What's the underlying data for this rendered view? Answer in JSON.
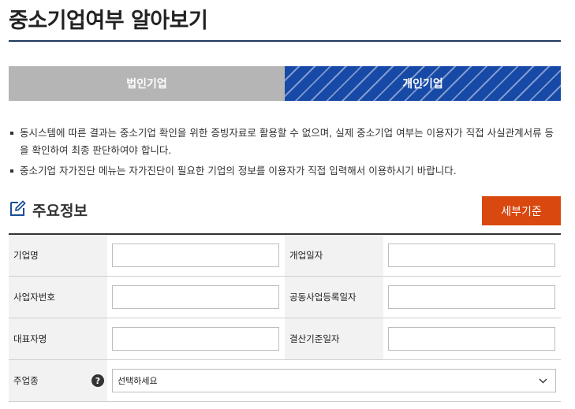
{
  "page": {
    "title": "중소기업여부 알아보기"
  },
  "tabs": [
    {
      "label": "법인기업",
      "active": false
    },
    {
      "label": "개인기업",
      "active": true
    }
  ],
  "notice": {
    "items": [
      "동시스템에 따른 결과는 중소기업 확인을 위한 증빙자료로 활용할 수 없으며, 실제 중소기업 여부는 이용자가 직접 사실관계서류 등을 확인하여 최종 판단하여야 합니다.",
      "중소기업 자가진단 메뉴는 자가진단이 필요한 기업의 정보를 이용자가 직접 입력해서 이용하시기 바랍니다."
    ]
  },
  "section": {
    "title": "주요정보",
    "detail_button": "세부기준"
  },
  "form": {
    "company_name": "기업명",
    "open_date": "개업일자",
    "biz_reg_no": "사업자번호",
    "joint_reg_date": "공동사업등록일자",
    "representative": "대표자명",
    "settlement_date": "결산기준일자",
    "main_industry": "주업종",
    "main_industry_select": "선택하세요"
  },
  "colors": {
    "tab_inactive": "#b5b5b5",
    "tab_active": "#1749a6",
    "detail_button": "#d9480f",
    "title_rule": "#1f3a5f"
  }
}
